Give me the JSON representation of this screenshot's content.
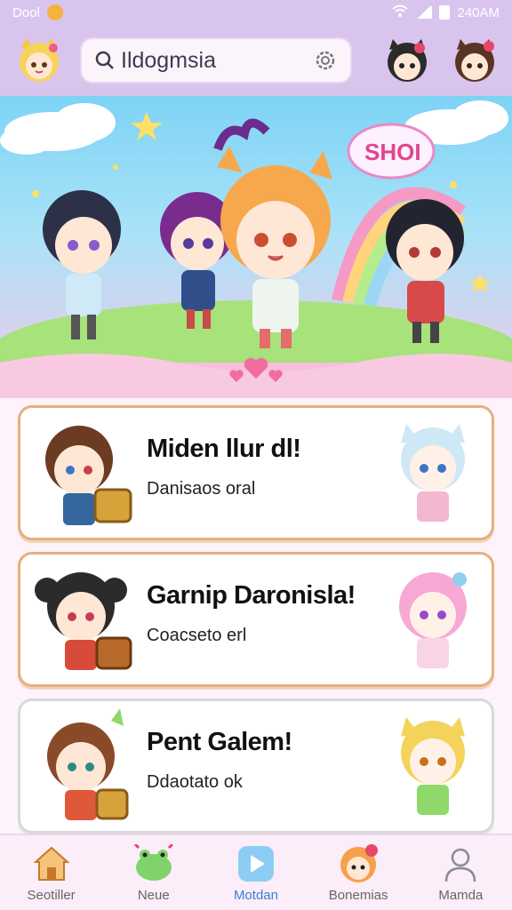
{
  "status": {
    "left_text": "Dool",
    "right_text": "240AM"
  },
  "search": {
    "value": "Ildogmsia"
  },
  "hero": {
    "banner_text": "SHOI"
  },
  "cards": [
    {
      "title": "Miden llur dl!",
      "subtitle": "Danisaos oral"
    },
    {
      "title": "Garnip Daronisla!",
      "subtitle": "Coacseto erl"
    },
    {
      "title": "Pent Galem!",
      "subtitle": "Ddaotato ok"
    }
  ],
  "nav": [
    {
      "label": "Seotiller",
      "icon": "home-icon"
    },
    {
      "label": "Neue",
      "icon": "frog-icon"
    },
    {
      "label": "Motdan",
      "icon": "play-icon"
    },
    {
      "label": "Bonemias",
      "icon": "character-icon"
    },
    {
      "label": "Mamda",
      "icon": "profile-icon"
    }
  ],
  "colors": {
    "header": "#d9c4ee",
    "card_border": "#e6b07c",
    "nav_active": "#3a7fd8"
  }
}
